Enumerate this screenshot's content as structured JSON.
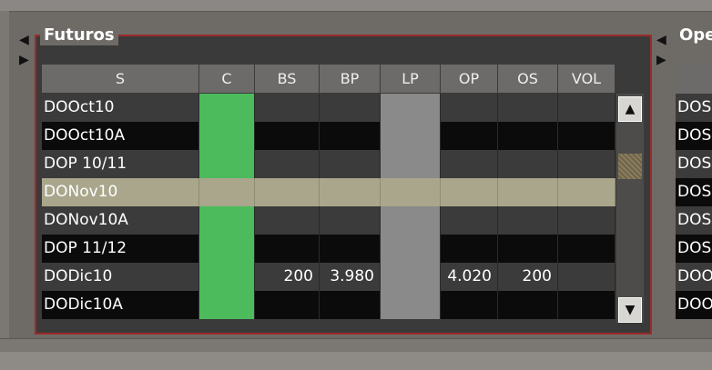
{
  "panel": {
    "title": "Futuros"
  },
  "right_panel": {
    "title": "Ope",
    "rows": [
      "DOS",
      "DOS",
      "DOS",
      "DOS",
      "DOS",
      "DOS",
      "DOO",
      "DOO"
    ]
  },
  "table": {
    "columns": [
      "S",
      "C",
      "BS",
      "BP",
      "LP",
      "OP",
      "OS",
      "VOL"
    ],
    "rows": [
      {
        "symbol": "DOOct10",
        "status": "green",
        "bs": "",
        "bp": "",
        "op": "",
        "os": "",
        "vol": ""
      },
      {
        "symbol": "DOOct10A",
        "status": "green",
        "bs": "",
        "bp": "",
        "op": "",
        "os": "",
        "vol": ""
      },
      {
        "symbol": "DOP 10/11",
        "status": "green",
        "bs": "",
        "bp": "",
        "op": "",
        "os": "",
        "vol": ""
      },
      {
        "symbol": "DONov10",
        "status": "selected",
        "bs": "",
        "bp": "",
        "op": "",
        "os": "",
        "vol": ""
      },
      {
        "symbol": "DONov10A",
        "status": "green",
        "bs": "",
        "bp": "",
        "op": "",
        "os": "",
        "vol": ""
      },
      {
        "symbol": "DOP 11/12",
        "status": "green",
        "bs": "",
        "bp": "",
        "op": "",
        "os": "",
        "vol": ""
      },
      {
        "symbol": "DODic10",
        "status": "green",
        "bs": "200",
        "bp": "3.980",
        "op": "4.020",
        "os": "200",
        "vol": ""
      },
      {
        "symbol": "DODic10A",
        "status": "green",
        "bs": "",
        "bp": "",
        "op": "",
        "os": "",
        "vol": ""
      }
    ]
  },
  "colors": {
    "status_green": "#4cbb5c",
    "lp_gray": "#8a8a8a",
    "row_dark": "#0b0b0b",
    "row_mid": "#3b3b3b",
    "row_selected": "#a9a68c",
    "frame_red": "#9b2b2b"
  },
  "icons": {
    "scroll_up": "triangle-up-icon",
    "scroll_down": "triangle-down-icon",
    "collapse": "triangle-left-icon",
    "expand": "triangle-right-icon"
  }
}
